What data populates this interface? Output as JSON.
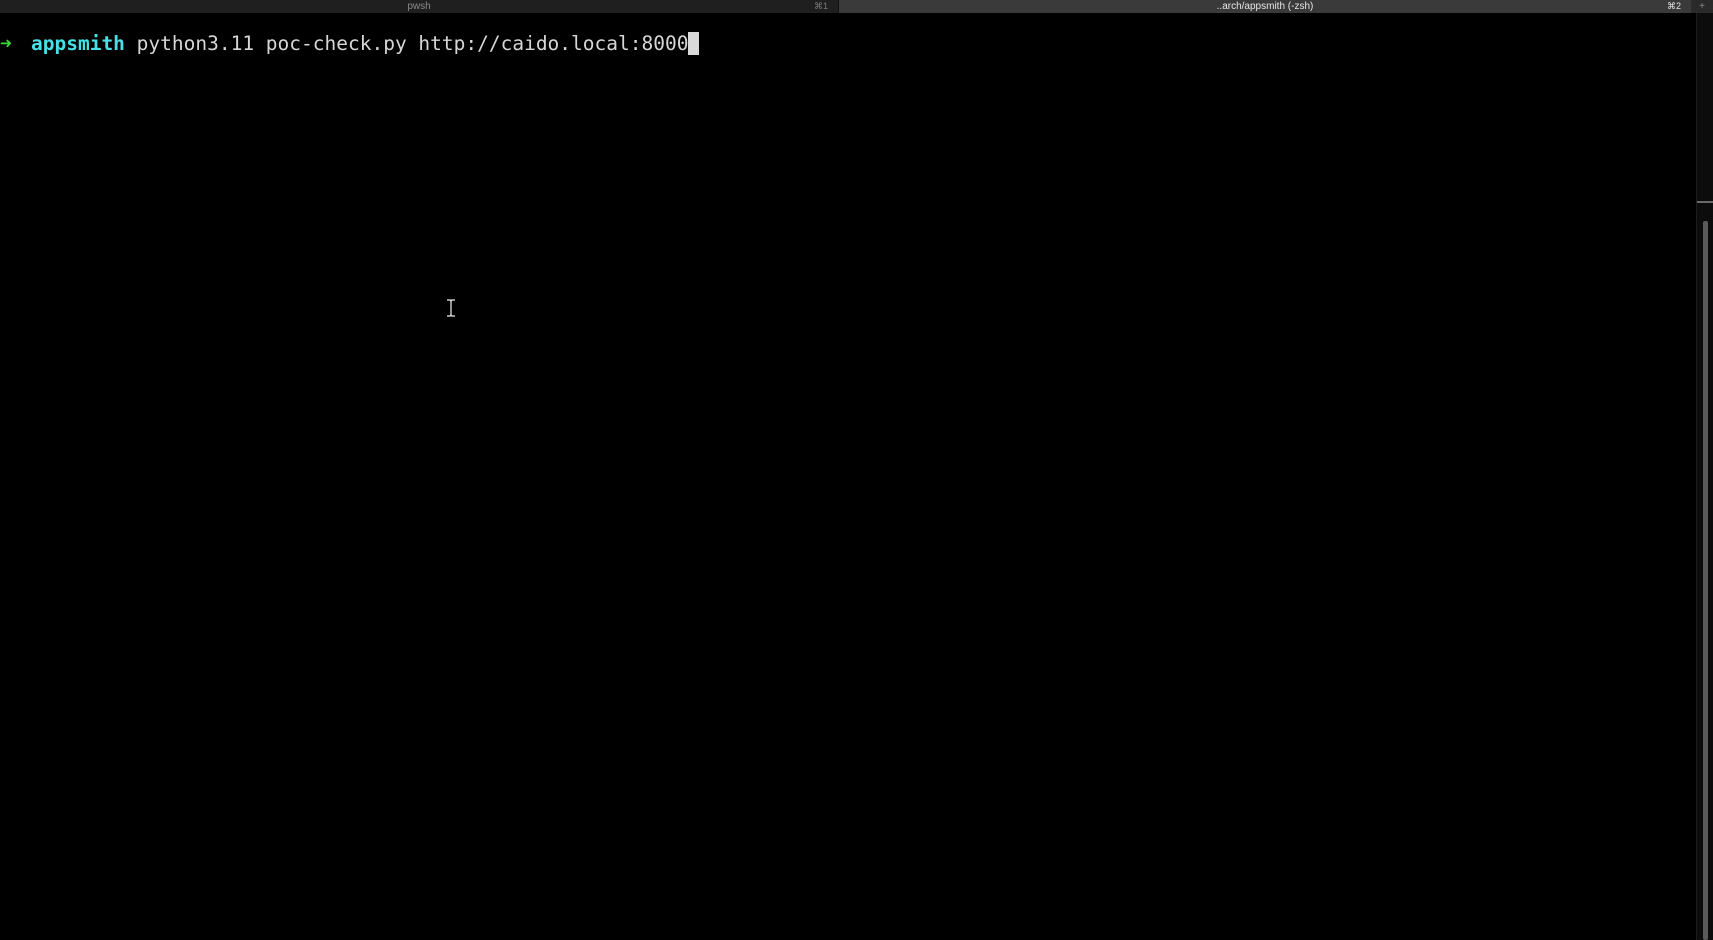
{
  "tabs": [
    {
      "title": "pwsh",
      "shortcut": "⌘1",
      "active": false
    },
    {
      "title": "..arch/appsmith (-zsh)",
      "shortcut": "⌘2",
      "active": true
    }
  ],
  "new_tab_label": "+",
  "terminal": {
    "prompt_symbol": "➜",
    "directory": "appsmith",
    "command": " python3.11 poc-check.py http://caido.local:8000"
  },
  "colors": {
    "background": "#000000",
    "prompt_arrow": "#3cd63c",
    "directory": "#46e0e6",
    "command_text": "#d6d6d6"
  },
  "icons": {
    "mouse_cursor": "ibeam-cursor-icon"
  }
}
